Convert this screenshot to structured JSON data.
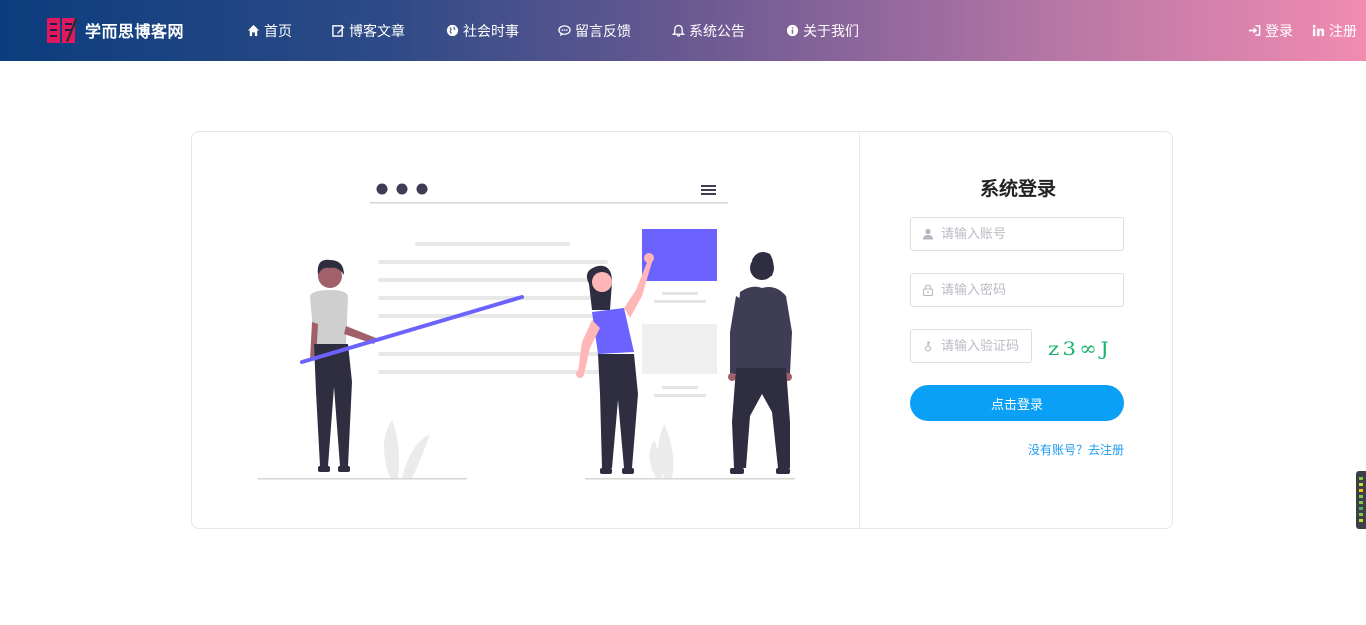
{
  "header": {
    "brand_name": "学而思博客网",
    "nav": [
      {
        "label": "首页",
        "icon": "home-icon"
      },
      {
        "label": "博客文章",
        "icon": "edit-icon"
      },
      {
        "label": "社会时事",
        "icon": "globe-icon"
      },
      {
        "label": "留言反馈",
        "icon": "comment-icon"
      },
      {
        "label": "系统公告",
        "icon": "bell-icon"
      },
      {
        "label": "关于我们",
        "icon": "info-icon"
      }
    ],
    "right": [
      {
        "label": "登录",
        "icon": "sign-in-icon"
      },
      {
        "label": "注册",
        "icon": "linkedin-icon"
      }
    ]
  },
  "login": {
    "title": "系统登录",
    "username_placeholder": "请输入账号",
    "password_placeholder": "请输入密码",
    "captcha_placeholder": "请输入验证码",
    "captcha_text": "z3∞J",
    "submit_label": "点击登录",
    "register_link": "没有账号？去注册"
  },
  "colors": {
    "primary_button": "#0aa0f5",
    "link": "#1b9cf0",
    "nav_gradient_start": "#0b3d7e",
    "nav_gradient_end": "#f18bb0",
    "illustration_accent": "#6c63ff"
  }
}
